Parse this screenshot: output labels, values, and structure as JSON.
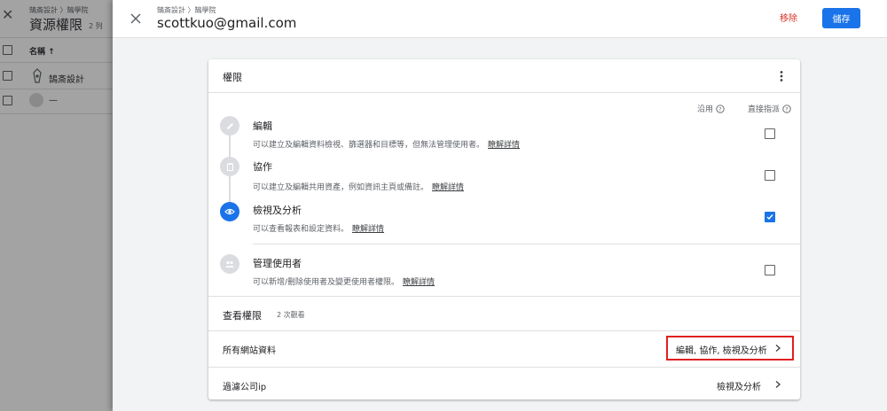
{
  "background_panel": {
    "breadcrumb": "鵠斎設計 〉鵠學院",
    "title": "資源權限",
    "count": "2 列",
    "column_name": "名稱 ↑",
    "rows": [
      {
        "label": "鵠斎設計"
      },
      {
        "label": "—"
      }
    ]
  },
  "header": {
    "breadcrumb": "鵠斎設計 〉鵠學院",
    "email": "scottkuo@gmail.com",
    "remove_label": "移除",
    "save_label": "儲存"
  },
  "permissions": {
    "title": "權限",
    "col_inherited": "沿用",
    "col_direct": "直接指派",
    "learn_more": "瞭解詳情",
    "roles": [
      {
        "title": "編輯",
        "desc": "可以建立及編輯資料檢視、篩選器和目標等，但無法管理使用者。",
        "checked": false,
        "icon": "pencil-icon"
      },
      {
        "title": "協作",
        "desc": "可以建立及編輯共用資產，例如資訊主頁或備註。",
        "checked": false,
        "icon": "clipboard-icon"
      },
      {
        "title": "檢視及分析",
        "desc": "可以查看報表和設定資料。",
        "checked": true,
        "icon": "eye-icon"
      },
      {
        "title": "管理使用者",
        "desc": "可以新增/刪除使用者及變更使用者權限。",
        "checked": false,
        "icon": "people-icon"
      }
    ]
  },
  "view_permissions": {
    "title": "查看權限",
    "count": "2 次觀看",
    "rows": [
      {
        "label": "所有網站資料",
        "value": "編輯, 協作, 檢視及分析"
      },
      {
        "label": "過濾公司ip",
        "value": "檢視及分析"
      }
    ]
  },
  "colors": {
    "accent": "#1a73e8",
    "danger": "#d93025",
    "highlight": "#e02020"
  }
}
